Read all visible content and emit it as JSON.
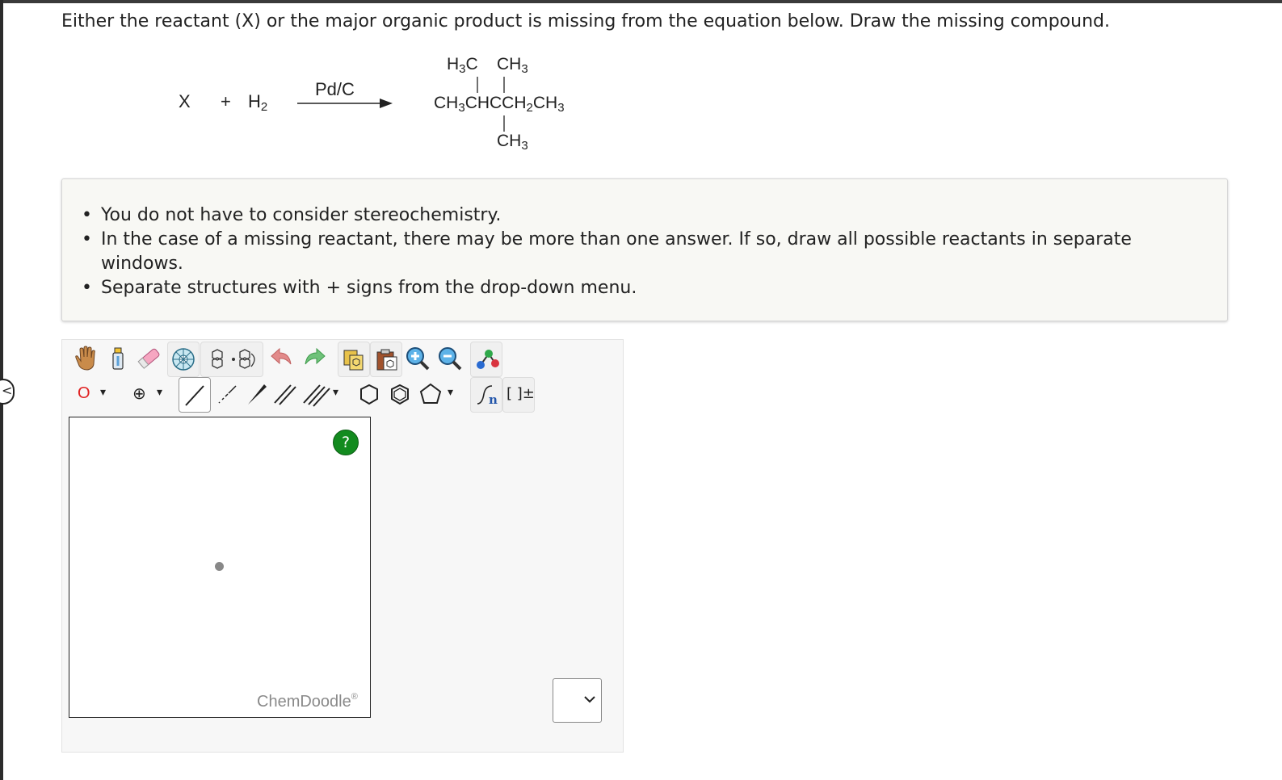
{
  "question": "Either the reactant (X) or the major organic product is missing from the equation below. Draw the missing compound.",
  "reaction": {
    "reactant": "X",
    "plus": "+",
    "reagent": "H",
    "reagent_sub": "2",
    "catalyst": "Pd/C",
    "product_top_left": "H",
    "product_top_left_sub": "3",
    "product_top_left_tail": "C",
    "product_top_right": "CH",
    "product_top_right_sub": "3",
    "product_main_parts": [
      "CH",
      "3",
      "CHCCH",
      "2",
      "CH",
      "3"
    ],
    "product_bottom": "CH",
    "product_bottom_sub": "3"
  },
  "instructions": [
    "You do not have to consider stereochemistry.",
    "In the case of a missing reactant, there may be more than one answer. If so, draw all possible reactants in separate windows.",
    "Separate structures with + signs from the drop-down menu."
  ],
  "toolbar": {
    "atom_label": "O",
    "charge_symbol": "⊕",
    "bracket_label": "[ ]±",
    "subscript_label": "n",
    "dropdown_arrow": "▾"
  },
  "editor": {
    "help_label": "?",
    "brand": "ChemDoodle",
    "brand_mark": "®"
  },
  "structure_menu": {
    "selected": "",
    "arrow": "⌄"
  },
  "colors": {
    "help_green": "#138b1f",
    "atom_red": "#e02020",
    "undo_pink": "#e28a8a",
    "redo_green": "#6fc27a"
  }
}
